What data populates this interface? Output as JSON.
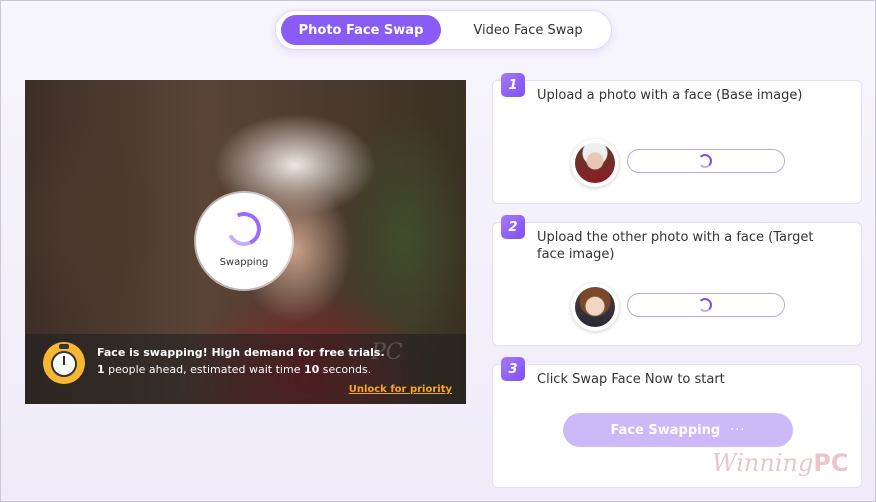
{
  "tabs": [
    {
      "label": "Photo Face Swap",
      "active": true
    },
    {
      "label": "Video Face Swap",
      "active": false
    }
  ],
  "preview": {
    "status_label": "Swapping",
    "banner": {
      "headline": "Face is swapping! High demand for free trials.",
      "people_ahead": "1",
      "ahead_text": " people ahead, estimated wait time ",
      "wait_time": "10",
      "wait_unit": " seconds.",
      "unlock_link": "Unlock for priority"
    },
    "watermark": "PC"
  },
  "steps": [
    {
      "number": "1",
      "text": "Upload a photo with a face (Base image)"
    },
    {
      "number": "2",
      "text": "Upload the other photo with a face (Target face image)"
    },
    {
      "number": "3",
      "text": "Click Swap Face Now to start",
      "button_label": "Face Swapping",
      "button_dots": "···"
    }
  ],
  "watermark": {
    "script": "Winning",
    "bold": "PC"
  },
  "colors": {
    "accent": "#8a5cf6",
    "button_disabled": "#cbbaf7",
    "link": "#f5a623"
  }
}
